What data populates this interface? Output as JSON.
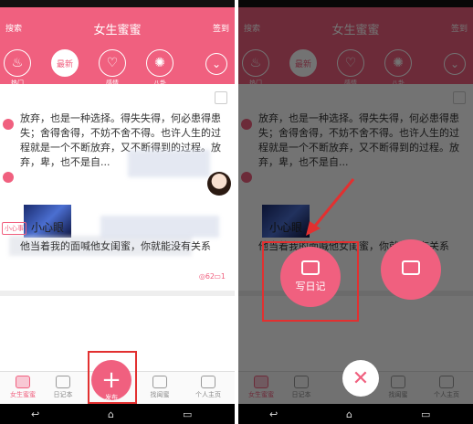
{
  "header": {
    "title": "女生蜜蜜",
    "search": "搜索",
    "signin": "签到"
  },
  "categories": [
    {
      "label": "热门",
      "icon": "fire-icon",
      "glyph": "♨"
    },
    {
      "label": "最新",
      "icon": "new-icon",
      "glyph": "最新"
    },
    {
      "label": "感情",
      "icon": "heart-icon",
      "glyph": "♡"
    },
    {
      "label": "八卦",
      "icon": "gossip-icon",
      "glyph": "✺"
    }
  ],
  "post1": {
    "text": "放弃，也是一种选择。得失失得，何必患得患失；舍得舍得，不妨不舍不得。也许人生的过程就是一个不断放弃，又不断得到的过程。放弃，卑，也不是自...",
    "views": "62",
    "comments": "1"
  },
  "post2": {
    "tag": "小心事",
    "title": "小心眼",
    "text": "他当着我的面喊他女闺蜜，你就能没有关系"
  },
  "tabs": [
    {
      "label": "女生蜜蜜"
    },
    {
      "label": "日记本"
    },
    {
      "label": "发布"
    },
    {
      "label": "找闺蜜"
    },
    {
      "label": "个人主页"
    }
  ],
  "overlay": {
    "write_diary": "写日记"
  },
  "colors": {
    "brand": "#f0607f",
    "highlight": "#e23030"
  }
}
